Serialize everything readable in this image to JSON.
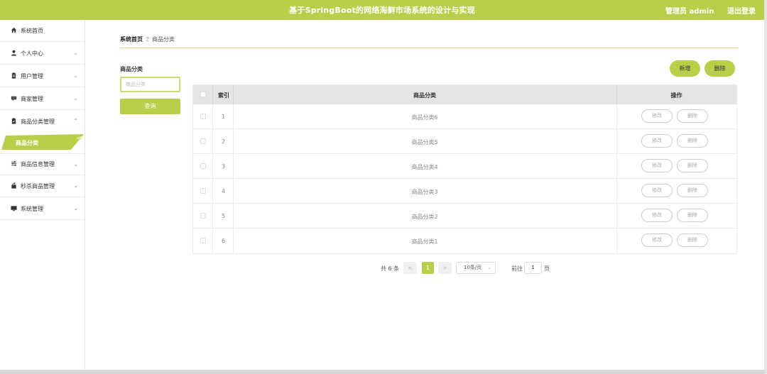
{
  "header": {
    "title": "基于SpringBoot的网络海鲜市场系统的设计与实现",
    "user": "管理员 admin",
    "logout": "退出登录"
  },
  "sidebar": {
    "items": [
      {
        "label": "系统首页",
        "icon": "home-icon"
      },
      {
        "label": "个人中心",
        "icon": "user-icon"
      },
      {
        "label": "用户管理",
        "icon": "clipboard-icon"
      },
      {
        "label": "商家管理",
        "icon": "message-icon"
      },
      {
        "label": "商品分类管理",
        "icon": "doc-icon"
      },
      {
        "label": "商品信息管理",
        "icon": "sliders-icon"
      },
      {
        "label": "秒杀商品管理",
        "icon": "bag-icon"
      },
      {
        "label": "系统管理",
        "icon": "monitor-icon"
      }
    ],
    "active_sub": "商品分类"
  },
  "breadcrumb": {
    "home": "系统首页",
    "separator": "Ξ",
    "current": "商品分类"
  },
  "search": {
    "label": "商品分类",
    "placeholder": "商品分类",
    "button": "查询"
  },
  "actions": {
    "add": "新增",
    "delete": "删除"
  },
  "table": {
    "headers": {
      "index": "索引",
      "name": "商品分类",
      "op": "操作"
    },
    "rows": [
      {
        "index": "1",
        "name": "商品分类6"
      },
      {
        "index": "2",
        "name": "商品分类5"
      },
      {
        "index": "3",
        "name": "商品分类4"
      },
      {
        "index": "4",
        "name": "商品分类3"
      },
      {
        "index": "5",
        "name": "商品分类2"
      },
      {
        "index": "6",
        "name": "商品分类1"
      }
    ],
    "edit_label": "修改",
    "delete_label": "删除"
  },
  "pagination": {
    "total": "共 6 条",
    "prev": "<",
    "current": "1",
    "next": ">",
    "page_size": "10条/页",
    "goto": "前往",
    "page_value": "1",
    "unit": "页"
  },
  "colors": {
    "accent": "#b8cf49"
  }
}
